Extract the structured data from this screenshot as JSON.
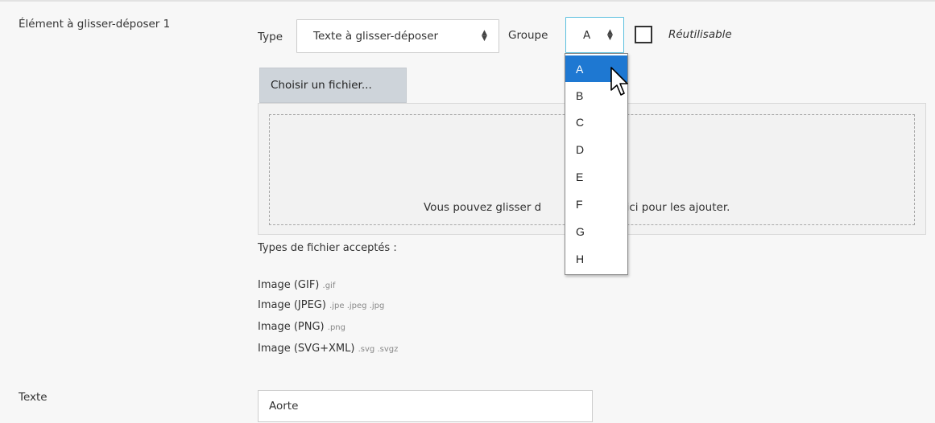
{
  "element": {
    "label": "Élément à glisser-déposer 1",
    "type_label": "Type",
    "type_value": "Texte à glisser-déposer",
    "group_label": "Groupe",
    "group_value": "A",
    "reusable_label": "Réutilisable",
    "reusable_checked": false
  },
  "file": {
    "choose_button": "Choisir un fichier...",
    "drop_text_left": "Vous pouvez glisser d",
    "drop_text_right": "s ici pour les ajouter.",
    "accepted_title": "Types de fichier acceptés :",
    "types": [
      {
        "name": "Image (GIF)",
        "ext": ".gif"
      },
      {
        "name": "Image (JPEG)",
        "ext": ".jpe .jpeg .jpg"
      },
      {
        "name": "Image (PNG)",
        "ext": ".png"
      },
      {
        "name": "Image (SVG+XML)",
        "ext": ".svg .svgz"
      }
    ]
  },
  "group_dropdown": {
    "options": [
      "A",
      "B",
      "C",
      "D",
      "E",
      "F",
      "G",
      "H"
    ],
    "selected": "A"
  },
  "text_field": {
    "label": "Texte",
    "value": "Aorte"
  },
  "icons": {
    "select_arrows": "updown-arrow-icon",
    "cursor": "mouse-pointer-icon"
  },
  "colors": {
    "selected_option": "#1e78d2",
    "focus_border": "#5bc0de",
    "file_button": "#ced4da"
  }
}
